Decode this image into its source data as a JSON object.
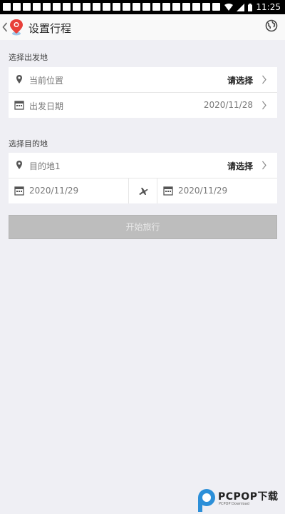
{
  "status_bar": {
    "time": "11:25"
  },
  "header": {
    "title": "设置行程"
  },
  "departure": {
    "section_label": "选择出发地",
    "location_label": "当前位置",
    "location_value": "请选择",
    "date_label": "出发日期",
    "date_value": "2020/11/28"
  },
  "destination": {
    "section_label": "选择目的地",
    "dest_label": "目的地1",
    "dest_value": "请选择",
    "start_date": "2020/11/29",
    "end_date": "2020/11/29"
  },
  "start_button": {
    "label": "开始旅行"
  },
  "watermark": {
    "text": "PCPOP下载",
    "subtext": "PCPOP Download"
  },
  "icons": {
    "back": "chevron-left-icon",
    "logo": "map-pin-logo-icon",
    "globe": "globe-icon",
    "location": "location-pin-icon",
    "calendar": "calendar-icon",
    "airplane": "airplane-icon",
    "chevron": "chevron-right-icon"
  },
  "colors": {
    "background": "#efeff4",
    "card": "#ffffff",
    "button_disabled": "#bdbdbd",
    "logo_red": "#e8403a",
    "status_bar": "#000000"
  }
}
